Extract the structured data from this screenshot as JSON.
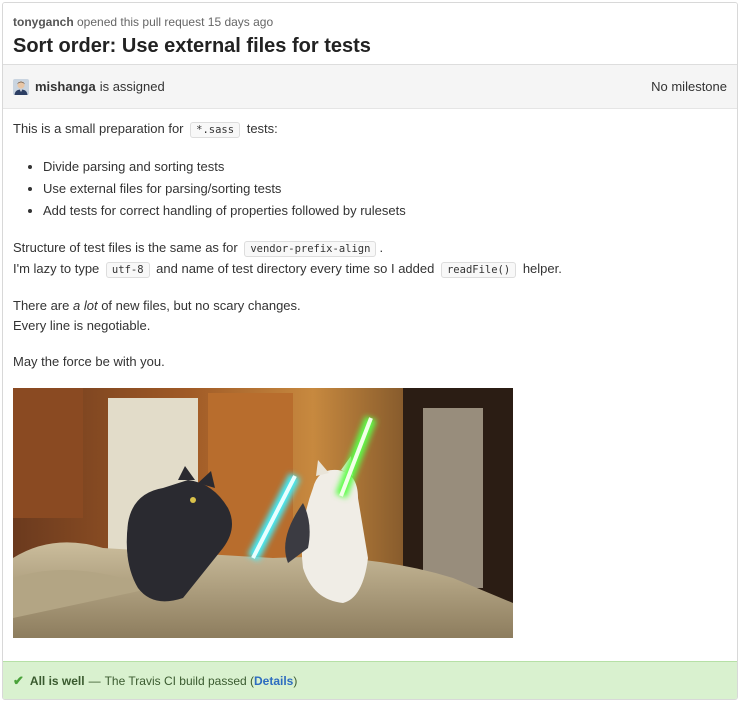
{
  "header": {
    "author": "tonyganch",
    "opened_text": " opened this pull request 15 days ago",
    "title": "Sort order: Use external files for tests"
  },
  "meta": {
    "assignee": "mishanga",
    "assigned_text": "is assigned",
    "milestone": "No milestone"
  },
  "body": {
    "intro_prefix": "This is a small preparation for",
    "intro_code": "*.sass",
    "intro_suffix": "tests:",
    "list": [
      "Divide parsing and sorting tests",
      "Use external files for parsing/sorting tests",
      "Add tests for correct handling of properties followed by rulesets"
    ],
    "structure_prefix": "Structure of test files is the same as for",
    "structure_code": "vendor-prefix-align",
    "structure_suffix": ".",
    "lazy_prefix": "I'm lazy to type",
    "lazy_code1": "utf-8",
    "lazy_mid": "and name of test directory every time so I added",
    "lazy_code2": "readFile()",
    "lazy_suffix": "helper.",
    "files_prefix": "There are",
    "files_em": "a lot",
    "files_suffix": "of new files, but no scary changes.",
    "negotiable": "Every line is negotiable.",
    "force": "May the force be with you."
  },
  "status": {
    "headline": "All is well",
    "dash": "—",
    "message": "The Travis CI build passed (",
    "link": "Details",
    "close": ")",
    "color": "#d9f1cf"
  },
  "icons": {
    "check": "check-icon",
    "avatar": "avatar-icon"
  }
}
